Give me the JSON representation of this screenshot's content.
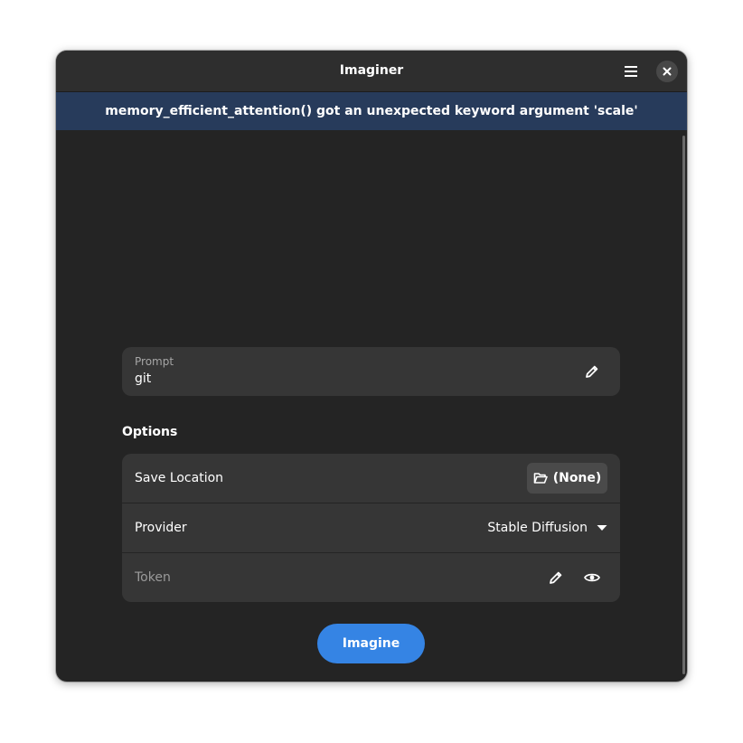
{
  "window": {
    "title": "Imaginer"
  },
  "header": {
    "menu_icon": "hamburger-menu-icon",
    "close_icon": "close-icon"
  },
  "banner": {
    "message": "memory_efficient_attention() got an unexpected keyword argument 'scale'"
  },
  "prompt": {
    "label": "Prompt",
    "value": "git",
    "edit_icon": "pencil-icon"
  },
  "options": {
    "title": "Options",
    "save_location": {
      "label": "Save Location",
      "button_label": "(None)",
      "icon": "folder-open-icon"
    },
    "provider": {
      "label": "Provider",
      "selected": "Stable Diffusion",
      "icon": "dropdown-arrow-icon"
    },
    "token": {
      "placeholder": "Token",
      "edit_icon": "pencil-icon",
      "reveal_icon": "eye-icon"
    }
  },
  "actions": {
    "imagine_label": "Imagine"
  },
  "colors": {
    "window_bg": "#242424",
    "headerbar_bg": "#2e2e2e",
    "banner_bg": "#273b5b",
    "card_bg": "#363636",
    "accent": "#3584e4"
  }
}
